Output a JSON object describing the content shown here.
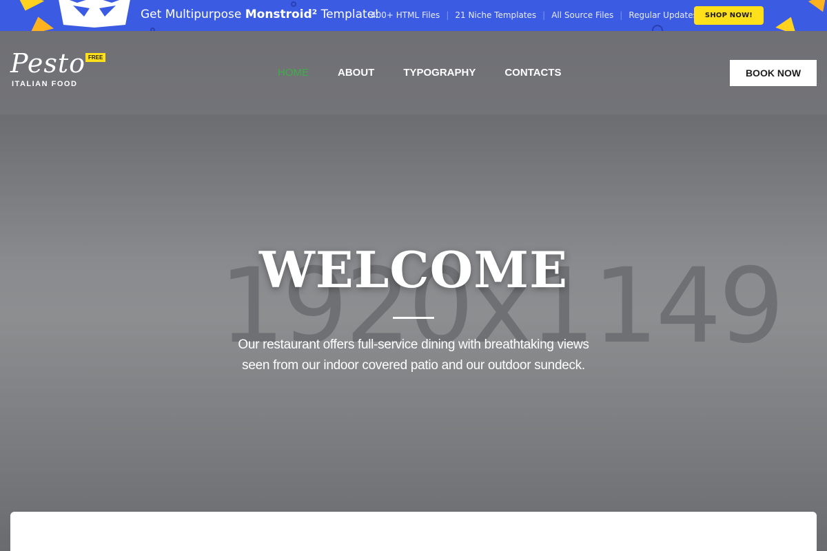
{
  "promo": {
    "headline_prefix": "Get Multipurpose ",
    "headline_brand": "Monstroid²",
    "headline_suffix": " Template!",
    "features": [
      "400+ HTML Files",
      "21 Niche Templates",
      "All Source Files",
      "Regular Updates"
    ],
    "shop_label": "SHOP NOW!",
    "colors": {
      "background": "#3b5be3",
      "button": "#ffe01b"
    }
  },
  "header": {
    "logo_script": "Pesto",
    "logo_sub": "ITALIAN FOOD",
    "badge": "FREE",
    "nav": [
      {
        "label": "HOME",
        "active": true
      },
      {
        "label": "ABOUT",
        "active": false
      },
      {
        "label": "TYPOGRAPHY",
        "active": false
      },
      {
        "label": "CONTACTS",
        "active": false
      }
    ],
    "book_label": "BOOK NOW",
    "active_color": "#3fae49"
  },
  "hero": {
    "placeholder": "1920x1149",
    "title": "WELCOME",
    "text_line1": "Our restaurant offers full-service dining with breathtaking views",
    "text_line2": "seen from our indoor covered patio and our outdoor sundeck."
  }
}
